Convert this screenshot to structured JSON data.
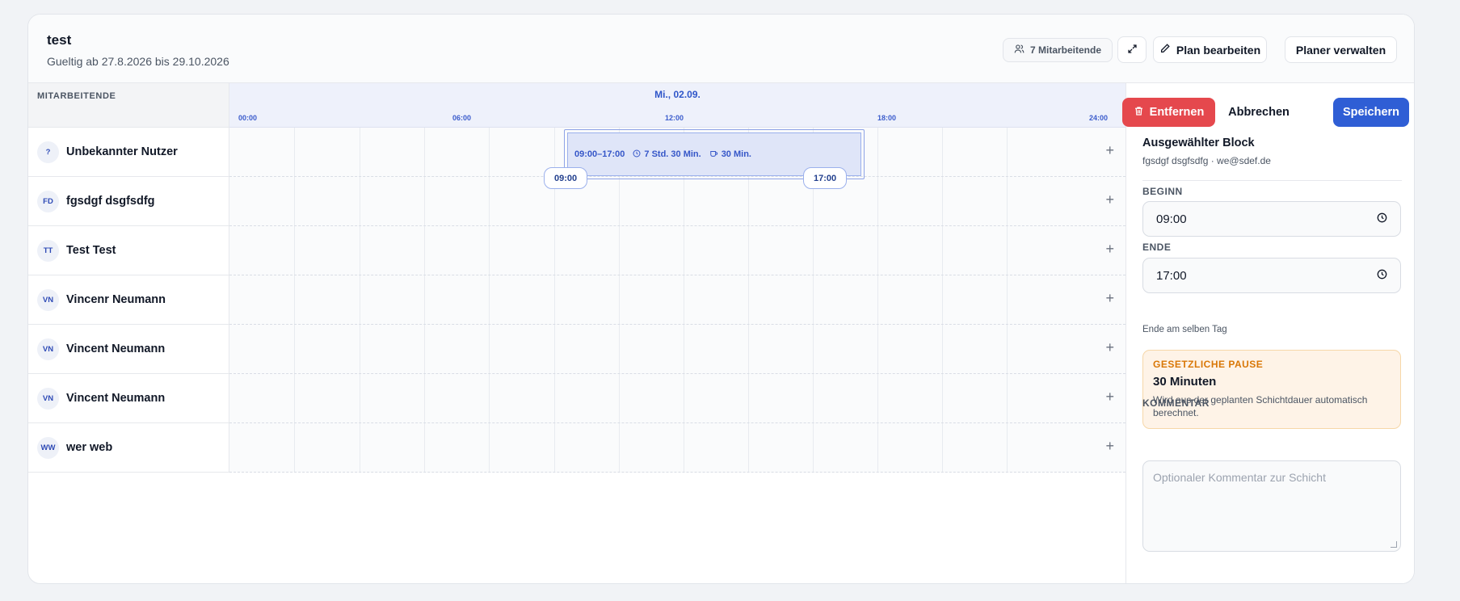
{
  "header": {
    "title": "test",
    "subtitle": "Gueltig ab 27.8.2026 bis 29.10.2026",
    "employees_pill": "7 Mitarbeitende",
    "edit_plan": "Plan bearbeiten",
    "manage_planner": "Planer verwalten"
  },
  "grid": {
    "employees_header": "MITARBEITENDE",
    "day_label": "Mi., 02.09.",
    "hours": [
      "00:00",
      "06:00",
      "12:00",
      "18:00",
      "24:00"
    ],
    "employees": [
      {
        "initials": "?",
        "name": "Unbekannter Nutzer"
      },
      {
        "initials": "FD",
        "name": "fgsdgf dsgfsdfg"
      },
      {
        "initials": "TT",
        "name": "Test Test"
      },
      {
        "initials": "VN",
        "name": "Vincenr Neumann"
      },
      {
        "initials": "VN",
        "name": "Vincent Neumann"
      },
      {
        "initials": "VN",
        "name": "Vincent Neumann"
      },
      {
        "initials": "WW",
        "name": "wer web"
      }
    ],
    "add_symbol": "+"
  },
  "block": {
    "range": "09:00–17:00",
    "duration": "7 Std. 30 Min.",
    "pause": "30 Min.",
    "start_handle": "09:00",
    "end_handle": "17:00"
  },
  "panel": {
    "remove": "Entfernen",
    "cancel": "Abbrechen",
    "save": "Speichern",
    "close": "×",
    "selected_title": "Ausgewählter Block",
    "selected_sub": "fgsdgf dsgfsdfg · we@sdef.de",
    "begin_label": "BEGINN",
    "begin_value": "09:00",
    "end_label": "ENDE",
    "end_value": "17:00",
    "end_hint": "Ende am selben Tag",
    "pause_label": "GESETZLICHE PAUSE",
    "pause_value": "30 Minuten",
    "pause_desc": "Wird aus der geplanten Schichtdauer automatisch berechnet.",
    "comment_label": "KOMMENTAR",
    "comment_placeholder": "Optionaler Kommentar zur Schicht"
  },
  "colors": {
    "accent": "#2f5ed5",
    "danger": "#e5484d",
    "warning": "#d97706"
  }
}
